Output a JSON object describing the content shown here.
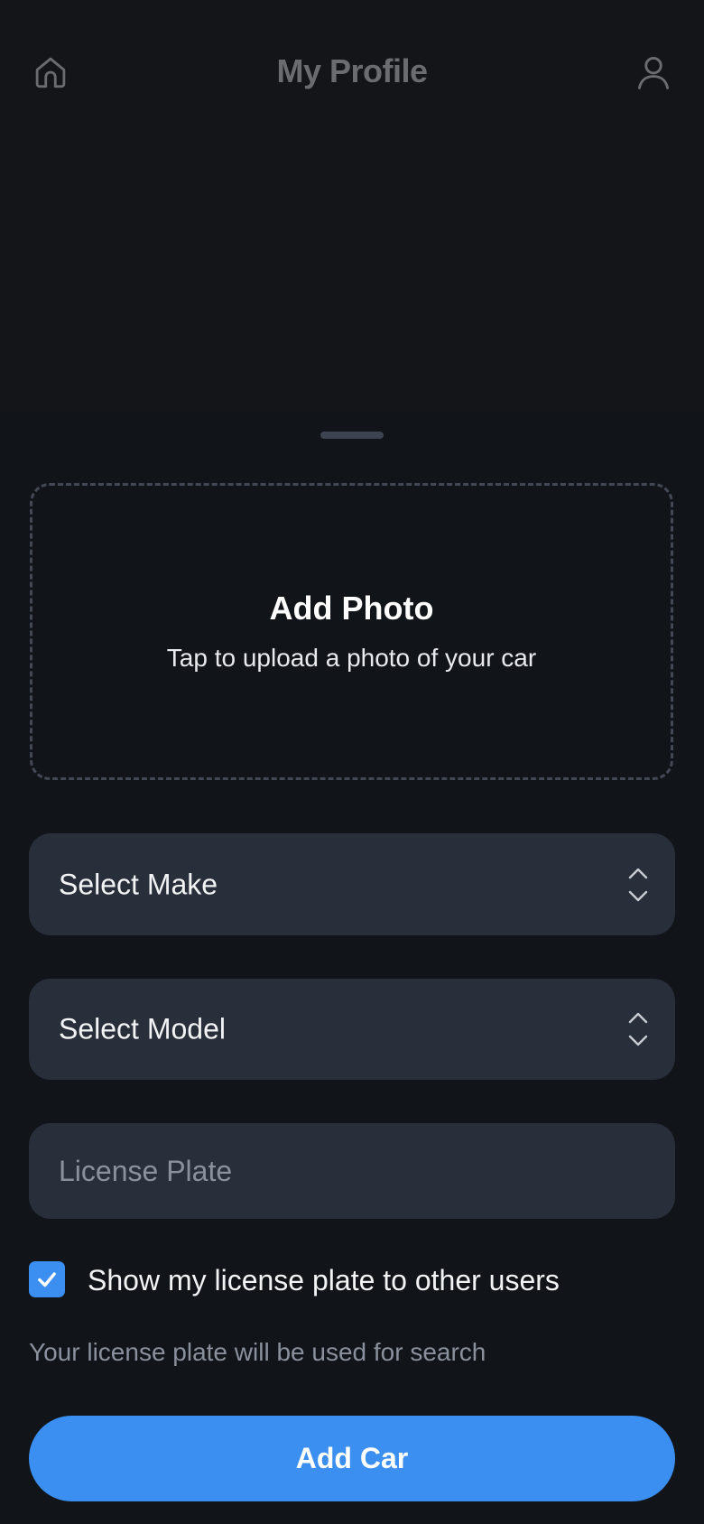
{
  "header": {
    "title": "My Profile",
    "left_icon": "home-icon",
    "right_icon": "user-icon"
  },
  "photo": {
    "title": "Add Photo",
    "subtitle": "Tap to upload a photo of your car"
  },
  "form": {
    "make_label": "Select Make",
    "model_label": "Select Model",
    "plate_placeholder": "License Plate",
    "plate_value": "",
    "show_plate_label": "Show my license plate to other users",
    "show_plate_checked": true,
    "hint": "Your license plate will be used for search"
  },
  "actions": {
    "add_car_label": "Add Car"
  },
  "colors": {
    "background": "#141518",
    "sheet": "#111418",
    "field": "#292f3a",
    "accent": "#3a8ff0",
    "muted_text": "#8a919c"
  }
}
